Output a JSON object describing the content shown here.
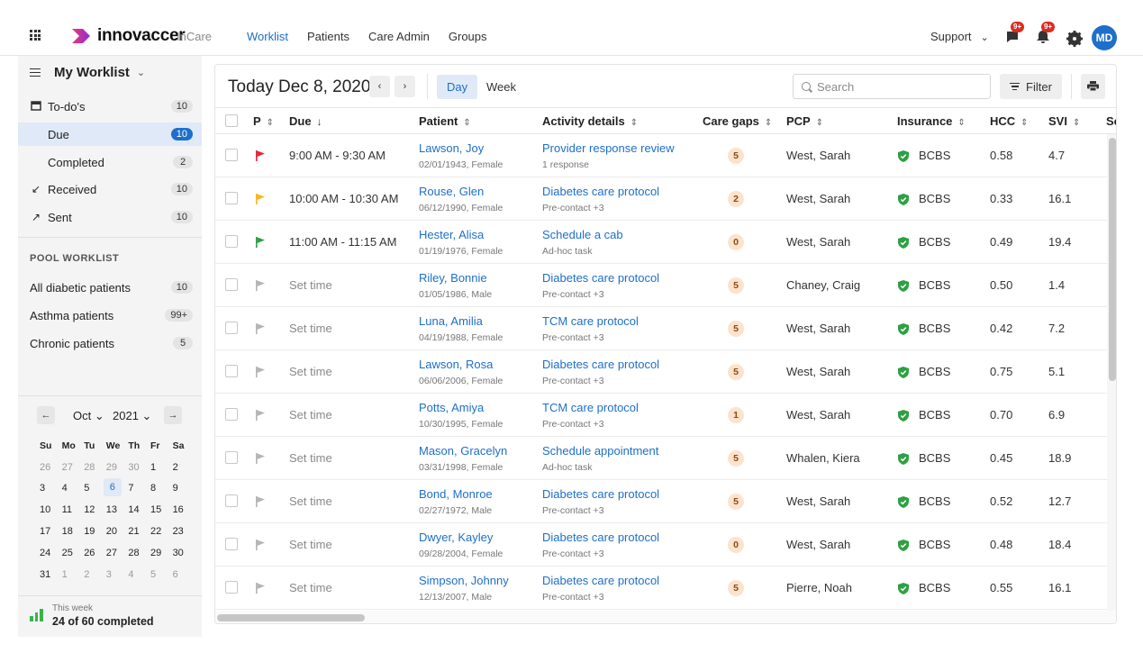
{
  "topbar": {
    "brand": "innovaccer",
    "product": "InCare",
    "nav": [
      "Worklist",
      "Patients",
      "Care Admin",
      "Groups"
    ],
    "support": "Support",
    "messages_badge": "9+",
    "alerts_badge": "9+",
    "avatar_initials": "MD"
  },
  "sidebar": {
    "title": "My Worklist",
    "todos": {
      "label": "To-do's",
      "count": "10"
    },
    "due": {
      "label": "Due",
      "count": "10"
    },
    "completed": {
      "label": "Completed",
      "count": "2"
    },
    "received": {
      "label": "Received",
      "count": "10"
    },
    "sent": {
      "label": "Sent",
      "count": "10"
    },
    "pool_title": "POOL WORKLIST",
    "pools": [
      {
        "label": "All diabetic patients",
        "count": "10"
      },
      {
        "label": "Asthma patients",
        "count": "99+"
      },
      {
        "label": "Chronic patients",
        "count": "5"
      }
    ]
  },
  "calendar": {
    "prev": "←",
    "next": "→",
    "month": "Oct",
    "year": "2021",
    "weekdays": [
      "Su",
      "Mo",
      "Tu",
      "We",
      "Th",
      "Fr",
      "Sa"
    ],
    "days": [
      "26",
      "27",
      "28",
      "29",
      "30",
      "1",
      "2",
      "3",
      "4",
      "5",
      "6",
      "7",
      "8",
      "9",
      "10",
      "11",
      "12",
      "13",
      "14",
      "15",
      "16",
      "17",
      "18",
      "19",
      "20",
      "21",
      "22",
      "23",
      "24",
      "25",
      "26",
      "27",
      "28",
      "29",
      "30",
      "31",
      "1",
      "2",
      "3",
      "4",
      "5",
      "6"
    ],
    "selected": "6"
  },
  "week": {
    "label": "This week",
    "value": "24 of 60 completed"
  },
  "toolbar": {
    "date": "Today Dec 8, 2020",
    "prev": "‹",
    "next": "›",
    "day": "Day",
    "week": "Week",
    "search_placeholder": "Search",
    "filter": "Filter"
  },
  "columns": {
    "p": "P",
    "due": "Due",
    "patient": "Patient",
    "activity": "Activity details",
    "care_gaps": "Care gaps",
    "pcp": "PCP",
    "insurance": "Insurance",
    "hcc": "HCC",
    "svi": "SVI",
    "next": "Sc"
  },
  "colors": {
    "accent": "#1d6fc9",
    "flag_red": "#e2263a",
    "flag_yellow": "#f5b722",
    "flag_green": "#2ea043",
    "flag_none": "#b5b5b5"
  },
  "rows": [
    {
      "flag": "red",
      "due": "9:00 AM - 9:30 AM",
      "name": "Lawson, Joy",
      "meta": "02/01/1943, Female",
      "activity": "Provider response review",
      "activity_meta": "1 response",
      "gaps": "5",
      "pcp": "West, Sarah",
      "insurance": "BCBS",
      "hcc": "0.58",
      "svi": "4.7"
    },
    {
      "flag": "yellow",
      "due": "10:00 AM - 10:30 AM",
      "name": "Rouse, Glen",
      "meta": "06/12/1990, Female",
      "activity": "Diabetes care protocol",
      "activity_meta": "Pre-contact +3",
      "gaps": "2",
      "pcp": "West, Sarah",
      "insurance": "BCBS",
      "hcc": "0.33",
      "svi": "16.1"
    },
    {
      "flag": "green",
      "due": "11:00 AM - 11:15 AM",
      "name": "Hester, Alisa",
      "meta": "01/19/1976, Female",
      "activity": "Schedule a cab",
      "activity_meta": "Ad-hoc task",
      "gaps": "0",
      "pcp": "West, Sarah",
      "insurance": "BCBS",
      "hcc": "0.49",
      "svi": "19.4"
    },
    {
      "flag": "none",
      "due": "Set time",
      "name": "Riley, Bonnie",
      "meta": "01/05/1986, Male",
      "activity": "Diabetes care protocol",
      "activity_meta": "Pre-contact +3",
      "gaps": "5",
      "pcp": "Chaney, Craig",
      "insurance": "BCBS",
      "hcc": "0.50",
      "svi": "1.4"
    },
    {
      "flag": "none",
      "due": "Set time",
      "name": "Luna, Amilia",
      "meta": "04/19/1988, Female",
      "activity": "TCM care protocol",
      "activity_meta": "Pre-contact +3",
      "gaps": "5",
      "pcp": "West, Sarah",
      "insurance": "BCBS",
      "hcc": "0.42",
      "svi": "7.2"
    },
    {
      "flag": "none",
      "due": "Set time",
      "name": "Lawson, Rosa",
      "meta": "06/06/2006, Female",
      "activity": "Diabetes care protocol",
      "activity_meta": "Pre-contact +3",
      "gaps": "5",
      "pcp": "West, Sarah",
      "insurance": "BCBS",
      "hcc": "0.75",
      "svi": "5.1"
    },
    {
      "flag": "none",
      "due": "Set time",
      "name": "Potts, Amiya",
      "meta": "10/30/1995, Female",
      "activity": "TCM care protocol",
      "activity_meta": "Pre-contact +3",
      "gaps": "1",
      "pcp": "West, Sarah",
      "insurance": "BCBS",
      "hcc": "0.70",
      "svi": "6.9"
    },
    {
      "flag": "none",
      "due": "Set time",
      "name": "Mason, Gracelyn",
      "meta": "03/31/1998, Female",
      "activity": "Schedule appointment",
      "activity_meta": "Ad-hoc task",
      "gaps": "5",
      "pcp": "Whalen, Kiera",
      "insurance": "BCBS",
      "hcc": "0.45",
      "svi": "18.9"
    },
    {
      "flag": "none",
      "due": "Set time",
      "name": "Bond, Monroe",
      "meta": "02/27/1972, Male",
      "activity": "Diabetes care protocol",
      "activity_meta": "Pre-contact +3",
      "gaps": "5",
      "pcp": "West, Sarah",
      "insurance": "BCBS",
      "hcc": "0.52",
      "svi": "12.7"
    },
    {
      "flag": "none",
      "due": "Set time",
      "name": "Dwyer, Kayley",
      "meta": "09/28/2004, Female",
      "activity": "Diabetes care protocol",
      "activity_meta": "Pre-contact +3",
      "gaps": "0",
      "pcp": "West, Sarah",
      "insurance": "BCBS",
      "hcc": "0.48",
      "svi": "18.4"
    },
    {
      "flag": "none",
      "due": "Set time",
      "name": "Simpson, Johnny",
      "meta": "12/13/2007, Male",
      "activity": "Diabetes care protocol",
      "activity_meta": "Pre-contact +3",
      "gaps": "5",
      "pcp": "Pierre, Noah",
      "insurance": "BCBS",
      "hcc": "0.55",
      "svi": "16.1"
    }
  ]
}
